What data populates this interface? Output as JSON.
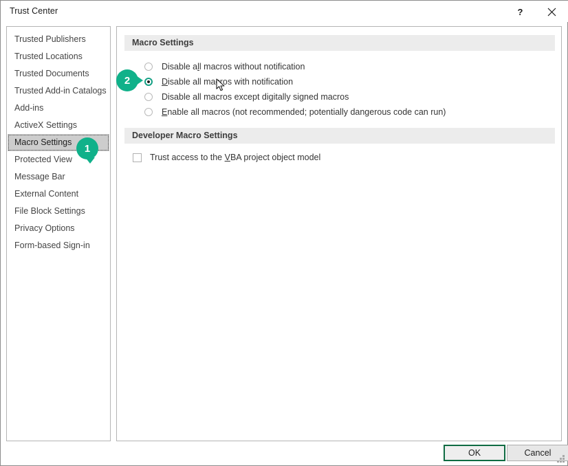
{
  "window": {
    "title": "Trust Center",
    "help_icon": "help-question-icon",
    "help_label": "?",
    "close_icon": "close-icon"
  },
  "sidebar": {
    "items": [
      {
        "label": "Trusted Publishers",
        "selected": false
      },
      {
        "label": "Trusted Locations",
        "selected": false
      },
      {
        "label": "Trusted Documents",
        "selected": false
      },
      {
        "label": "Trusted Add-in Catalogs",
        "selected": false
      },
      {
        "label": "Add-ins",
        "selected": false
      },
      {
        "label": "ActiveX Settings",
        "selected": false
      },
      {
        "label": "Macro Settings",
        "selected": true
      },
      {
        "label": "Protected View",
        "selected": false
      },
      {
        "label": "Message Bar",
        "selected": false
      },
      {
        "label": "External Content",
        "selected": false
      },
      {
        "label": "File Block Settings",
        "selected": false
      },
      {
        "label": "Privacy Options",
        "selected": false
      },
      {
        "label": "Form-based Sign-in",
        "selected": false
      }
    ]
  },
  "main": {
    "macro_section_title": "Macro Settings",
    "developer_section_title": "Developer Macro Settings",
    "options": [
      {
        "pre": "Disable a",
        "accel": "l",
        "post": "l macros without notification",
        "full": "Disable all macros without notification",
        "checked": false
      },
      {
        "pre": "",
        "accel": "D",
        "post": "isable all macros with notification",
        "full": "Disable all macros with notification",
        "checked": true
      },
      {
        "pre": "Disable all macros except di",
        "accel": "g",
        "post": "itally signed macros",
        "full": "Disable all macros except digitally signed macros",
        "checked": false
      },
      {
        "pre": "",
        "accel": "E",
        "post": "nable all macros (not recommended; potentially dangerous code can run)",
        "full": "Enable all macros (not recommended; potentially dangerous code can run)",
        "checked": false
      }
    ],
    "developer_option": {
      "pre": "Trust access to the ",
      "accel": "V",
      "post": "BA project object model",
      "full": "Trust access to the VBA project object model",
      "checked": false
    }
  },
  "footer": {
    "ok_label": "OK",
    "cancel_label": "Cancel"
  },
  "callouts": [
    {
      "number": "1"
    },
    {
      "number": "2"
    }
  ],
  "colors": {
    "accent_green": "#10b18a",
    "focus_border": "#0e6b42",
    "section_header_bg": "#ececec",
    "selected_nav_bg": "#cdcdcd"
  }
}
